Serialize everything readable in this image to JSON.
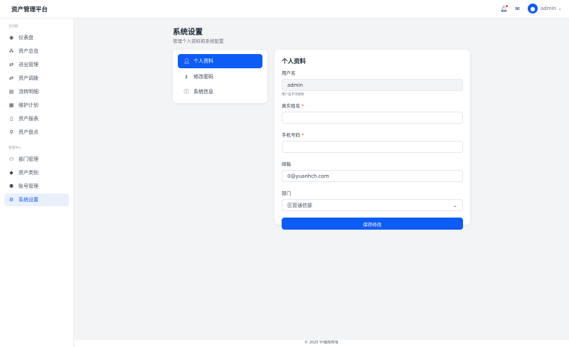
{
  "header": {
    "brand": "资产管理平台",
    "user": "admin"
  },
  "sidebar": {
    "section_main": "主功能",
    "main_items": [
      {
        "label": "仪表盘",
        "icon": "dashboard-icon"
      },
      {
        "label": "资产总览",
        "icon": "cubes-icon"
      },
      {
        "label": "进出管理",
        "icon": "exchange-icon"
      },
      {
        "label": "资产调拨",
        "icon": "exchange-icon"
      },
      {
        "label": "流转明细",
        "icon": "list-icon"
      },
      {
        "label": "维护计划",
        "icon": "calendar-icon"
      },
      {
        "label": "资产报表",
        "icon": "file-icon"
      },
      {
        "label": "资产盘点",
        "icon": "search-icon"
      }
    ],
    "section_admin": "管理中心",
    "admin_items": [
      {
        "label": "部门管理",
        "icon": "users-icon"
      },
      {
        "label": "资产类别",
        "icon": "tags-icon"
      },
      {
        "label": "账号管理",
        "icon": "user-cog-icon"
      },
      {
        "label": "系统设置",
        "icon": "gear-icon"
      }
    ]
  },
  "page": {
    "title": "系统设置",
    "subtitle": "管理个人资料和系统配置"
  },
  "settings_menu": [
    {
      "label": "个人资料"
    },
    {
      "label": "修改密码"
    },
    {
      "label": "系统信息"
    }
  ],
  "form": {
    "title": "个人资料",
    "username_label": "用户名",
    "username_value": "admin",
    "username_hint": "用户名不可修改",
    "realname_label": "真实姓名",
    "realname_value": "",
    "phone_label": "手机号码",
    "phone_value": "",
    "required_mark": "*",
    "email_label": "邮箱",
    "email_value": "0@yuanhch.com",
    "dept_label": "部门",
    "dept_value": "区管通信部",
    "save_label": "保存修改"
  },
  "footer": "© 2025 YH版权所有"
}
